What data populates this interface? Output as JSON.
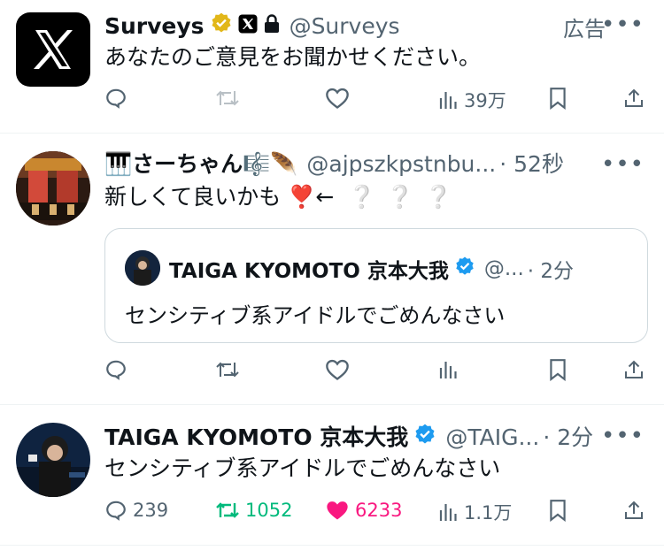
{
  "post1": {
    "name": "Surveys",
    "handle": "@Surveys",
    "ad_label": "広告",
    "more": "•••",
    "text": "あなたのご意見をお聞かせください。",
    "stats": {
      "reply": "",
      "repost": "",
      "like": "",
      "views": "39万"
    }
  },
  "post2": {
    "name": "🎹さーちゃん🎼🪶",
    "handle": "@ajpszkpstnbu...",
    "time": "· 52秒",
    "more": "•••",
    "text": "新しくて良いかも ❣️←",
    "text_tail": "❔❔❔",
    "quote": {
      "name": "TAIGA KYOMOTO 京本大我",
      "handle": "@...",
      "time": "· 2分",
      "text": "センシティブ系アイドルでごめんなさい"
    },
    "stats": {
      "reply": "",
      "repost": "",
      "like": "",
      "views": ""
    }
  },
  "post3": {
    "name": "TAIGA KYOMOTO 京本大我",
    "handle": "@TAIG...",
    "time": "· 2分",
    "more": "•••",
    "text": "センシティブ系アイドルでごめんなさい",
    "stats": {
      "reply": "239",
      "repost": "1052",
      "like": "6233",
      "views": "1.1万"
    }
  },
  "colors": {
    "repost_active": "#00ba7c",
    "like_active": "#f91880",
    "verified": "#1d9bf0",
    "gold": "#e2b719",
    "muted": "#536471"
  }
}
